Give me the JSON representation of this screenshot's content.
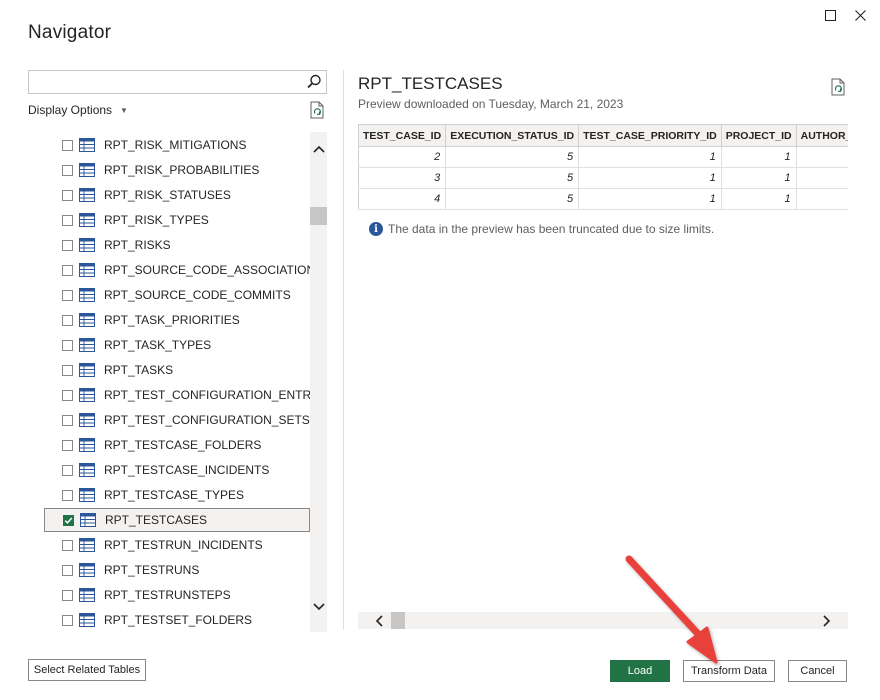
{
  "window": {
    "title": "Navigator",
    "maximize_icon": "maximize-icon",
    "close_icon": "close-icon"
  },
  "search": {
    "value": "",
    "placeholder": "",
    "icon": "search-icon"
  },
  "display_options": {
    "label": "Display Options",
    "icon": "chevron-down-icon"
  },
  "tree": {
    "items": [
      {
        "label": "RPT_RISK_MITIGATIONS",
        "checked": false
      },
      {
        "label": "RPT_RISK_PROBABILITIES",
        "checked": false
      },
      {
        "label": "RPT_RISK_STATUSES",
        "checked": false
      },
      {
        "label": "RPT_RISK_TYPES",
        "checked": false
      },
      {
        "label": "RPT_RISKS",
        "checked": false
      },
      {
        "label": "RPT_SOURCE_CODE_ASSOCIATIONS",
        "checked": false
      },
      {
        "label": "RPT_SOURCE_CODE_COMMITS",
        "checked": false
      },
      {
        "label": "RPT_TASK_PRIORITIES",
        "checked": false
      },
      {
        "label": "RPT_TASK_TYPES",
        "checked": false
      },
      {
        "label": "RPT_TASKS",
        "checked": false
      },
      {
        "label": "RPT_TEST_CONFIGURATION_ENTRIES",
        "checked": false
      },
      {
        "label": "RPT_TEST_CONFIGURATION_SETS",
        "checked": false
      },
      {
        "label": "RPT_TESTCASE_FOLDERS",
        "checked": false
      },
      {
        "label": "RPT_TESTCASE_INCIDENTS",
        "checked": false
      },
      {
        "label": "RPT_TESTCASE_TYPES",
        "checked": false
      },
      {
        "label": "RPT_TESTCASES",
        "checked": true,
        "selected": true
      },
      {
        "label": "RPT_TESTRUN_INCIDENTS",
        "checked": false
      },
      {
        "label": "RPT_TESTRUNS",
        "checked": false
      },
      {
        "label": "RPT_TESTRUNSTEPS",
        "checked": false
      },
      {
        "label": "RPT_TESTSET_FOLDERS",
        "checked": false
      }
    ]
  },
  "preview": {
    "title": "RPT_TESTCASES",
    "subtitle": "Preview downloaded on Tuesday, March 21, 2023",
    "columns": [
      "TEST_CASE_ID",
      "EXECUTION_STATUS_ID",
      "TEST_CASE_PRIORITY_ID",
      "PROJECT_ID",
      "AUTHOR_ID"
    ],
    "rows": [
      [
        "2",
        "5",
        "1",
        "1",
        ""
      ],
      [
        "3",
        "5",
        "1",
        "1",
        ""
      ],
      [
        "4",
        "5",
        "1",
        "1",
        ""
      ]
    ],
    "truncation_note": "The data in the preview has been truncated due to size limits."
  },
  "buttons": {
    "select_related": "Select Related Tables",
    "load": "Load",
    "transform": "Transform Data",
    "cancel": "Cancel"
  },
  "colors": {
    "load_button": "#217346",
    "annotation_arrow": "#e8413b",
    "info_icon": "#2b579a"
  }
}
